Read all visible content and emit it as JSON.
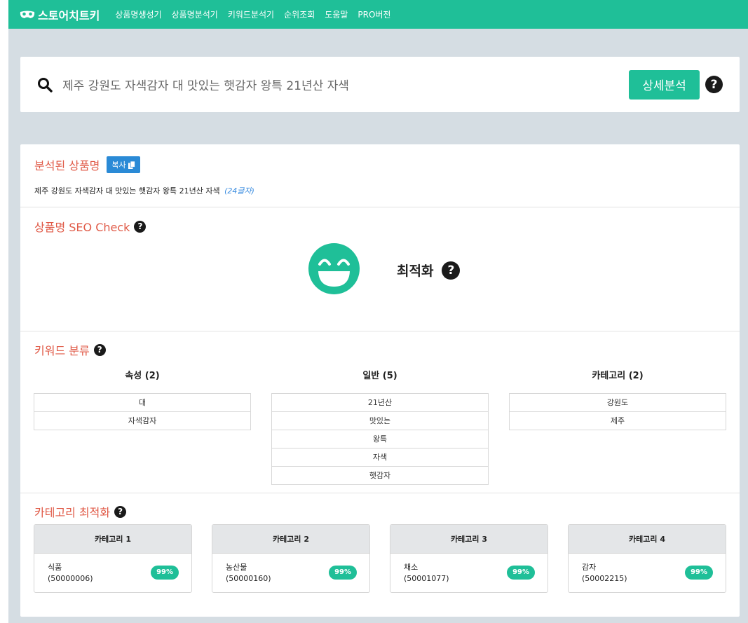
{
  "nav": {
    "brand": "스토어치트키",
    "items": [
      "상품명생성기",
      "상품명분석기",
      "키워드분석기",
      "순위조회",
      "도움말",
      "PRO버전"
    ]
  },
  "search": {
    "value": "제주 강원도 자색감자 대 맛있는 햇감자 왕특 21년산 자색",
    "button_label": "상세분석"
  },
  "analyzed": {
    "title": "분석된 상품명",
    "copy_label": "복사",
    "product_name": "제주 강원도 자색감자 대 맛있는 햇감자 왕특 21년산 자색",
    "char_count": "(24글자)"
  },
  "seo": {
    "title": "상품명 SEO Check",
    "status": "최적화"
  },
  "keywords": {
    "title": "키워드 분류",
    "columns": [
      {
        "header": "속성 (2)",
        "items": [
          "대",
          "자색감자"
        ]
      },
      {
        "header": "일반 (5)",
        "items": [
          "21년산",
          "맛있는",
          "왕특",
          "자색",
          "햇감자"
        ]
      },
      {
        "header": "카테고리 (2)",
        "items": [
          "강원도",
          "제주"
        ]
      }
    ]
  },
  "category": {
    "title": "카테고리 최적화",
    "boxes": [
      {
        "header": "카테고리 1",
        "name": "식품",
        "code": "(50000006)",
        "percent": "99%"
      },
      {
        "header": "카테고리 2",
        "name": "농산물",
        "code": "(50000160)",
        "percent": "99%"
      },
      {
        "header": "카테고리 3",
        "name": "채소",
        "code": "(50001077)",
        "percent": "99%"
      },
      {
        "header": "카테고리 4",
        "name": "감자",
        "code": "(50002215)",
        "percent": "99%"
      }
    ]
  },
  "help_glyph": "?",
  "colors": {
    "accent": "#1fbf98",
    "title_red": "#e05a47",
    "copy_blue": "#2a8ad6"
  },
  "icons": [
    "mask-icon",
    "search-icon",
    "help-icon",
    "copy-icon",
    "smiley-icon"
  ]
}
